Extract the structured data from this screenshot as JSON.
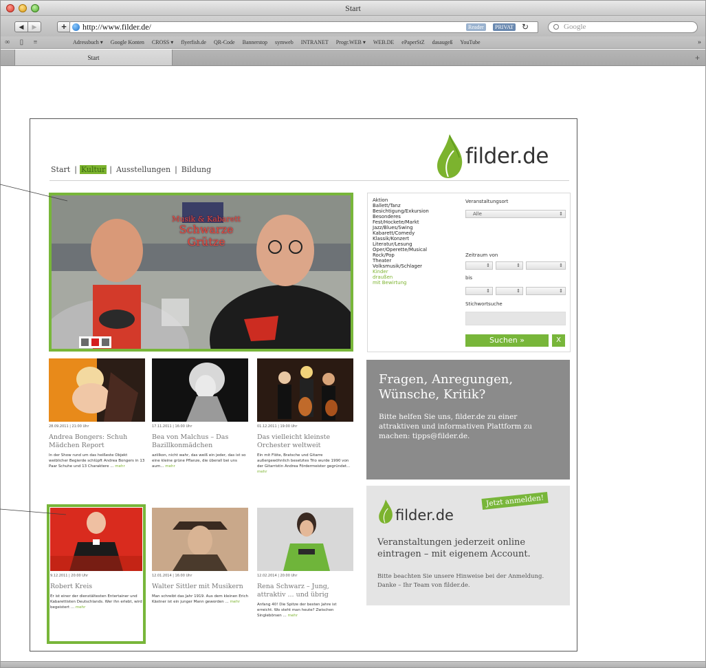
{
  "browser": {
    "window_title": "Start",
    "url": "http://www.filder.de/",
    "reader_label": "Reader",
    "privat_label": "PRIVAT",
    "search_placeholder": "Google",
    "bookmarks": [
      "Adressbuch ▾",
      "Google Konten",
      "CROSS ▾",
      "flyerfish.de",
      "QR-Code",
      "Bannerstop",
      "symweb",
      "INTRANET",
      "Progr.WEB ▾",
      "WEB.DE",
      "ePaperStZ",
      "dasaugeß",
      "YouTube"
    ],
    "tab_label": "Start"
  },
  "site": {
    "logo_text": "filder.de",
    "nav": {
      "start": "Start",
      "kultur": "Kultur",
      "ausstellungen": "Ausstellungen",
      "bildung": "Bildung",
      "active": "Kultur"
    },
    "hero": {
      "subtitle": "Musik & Kabarett",
      "title_line1": "Schwarze",
      "title_line2": "Grütze",
      "active_slide": 2
    },
    "filter": {
      "categories": [
        "Aktion",
        "Ballett/Tanz",
        "Besichtigung/Exkursion",
        "Besonderes",
        "Fest/Hockete/Markt",
        "Jazz/Blues/Swing",
        "Kabarett/Comedy",
        "Klassik/Konzert",
        "Literatur/Lesung",
        "Oper/Operette/Musical",
        "Rock/Pop",
        "Theater",
        "Volksmusik/Schlager"
      ],
      "categories_green": [
        "Kinder",
        "draußen",
        "mit Bewirtung"
      ],
      "ort_label": "Veranstaltungsort",
      "ort_value": "Alle",
      "zeitraum_label": "Zeitraum von",
      "bis_label": "bis",
      "stichwort_label": "Stichwortsuche",
      "search_button": "Suchen »",
      "reset_button": "X"
    },
    "cards": [
      {
        "date": "28.09.2011 | 21:00 Uhr",
        "title": "Andrea Bongers: Schuh Mädchen Report",
        "text": "In der Show rund um das heißeste Objekt weiblicher Begierde schlüpft Andrea Bongers in 13 Paar Schuhe und 13 Charaktere ...",
        "more": "mehr"
      },
      {
        "date": "17.11.2011 | 16:00 Uhr",
        "title": "Bea von Malchus – Das Bazillkonmädchen",
        "text": "aziilkon, nicht wahr, das weiß ein jeder, das ist so eine kleine grüne Pflanze, die überall bei uns aum...",
        "more": "mehr"
      },
      {
        "date": "01.12.2011 | 19:00 Uhr",
        "title": "Das vielleicht kleinste Orchester weltweit",
        "text": "Ein mit Flöte, Bratsche und Gitarre außergewöhnlich besetztes Trio wurde 1990 von der Gitarristin Andrea Fördermeister gegründet...",
        "more": "mehr"
      },
      {
        "date": "9.12.2011 | 20:00 Uhr",
        "title": "Robert Kreis",
        "text": "Er ist einer der dienstältesten Entertainer und Kabarettisten Deutschlands. Wer ihn erlebt, wird begeistert ...",
        "more": "mehr"
      },
      {
        "date": "12.01.2014 | 16:00 Uhr",
        "title": "Walter Sittler mit Musikern",
        "text": "Man schreibt das Jahr 1919. Aus dem kleinen Erich Kästner ist ein junger Mann geworden ...",
        "more": "mehr"
      },
      {
        "date": "12.02.2014 | 20:00 Uhr",
        "title": "Rena Schwarz – Jung, attraktiv ... und übrig",
        "text": "Anfang 40! Die Spitze der besten Jahre ist erreicht. Wo steht man heute? Zwischen Singlebörsen ...",
        "more": "mehr"
      }
    ],
    "feedback": {
      "heading": "Fragen, Anregungen, Wünsche, Kritik?",
      "body": "Bitte helfen Sie uns, filder.de zu einer attraktiven und informativen Plattform zu machen: tipps@filder.de."
    },
    "register": {
      "logo_text": "filder.de",
      "badge": "Jetzt anmelden!",
      "heading": "Veranstaltungen jederzeit online eintragen – mit eigenem Account.",
      "body": "Bitte beachten Sie unsere Hinweise bei der Anmeldung. Danke – Ihr Team von filder.de."
    }
  },
  "colors": {
    "brand_green": "#78b63a",
    "feedback_grey": "#8b8b8b",
    "hero_red": "#e24a3b"
  }
}
